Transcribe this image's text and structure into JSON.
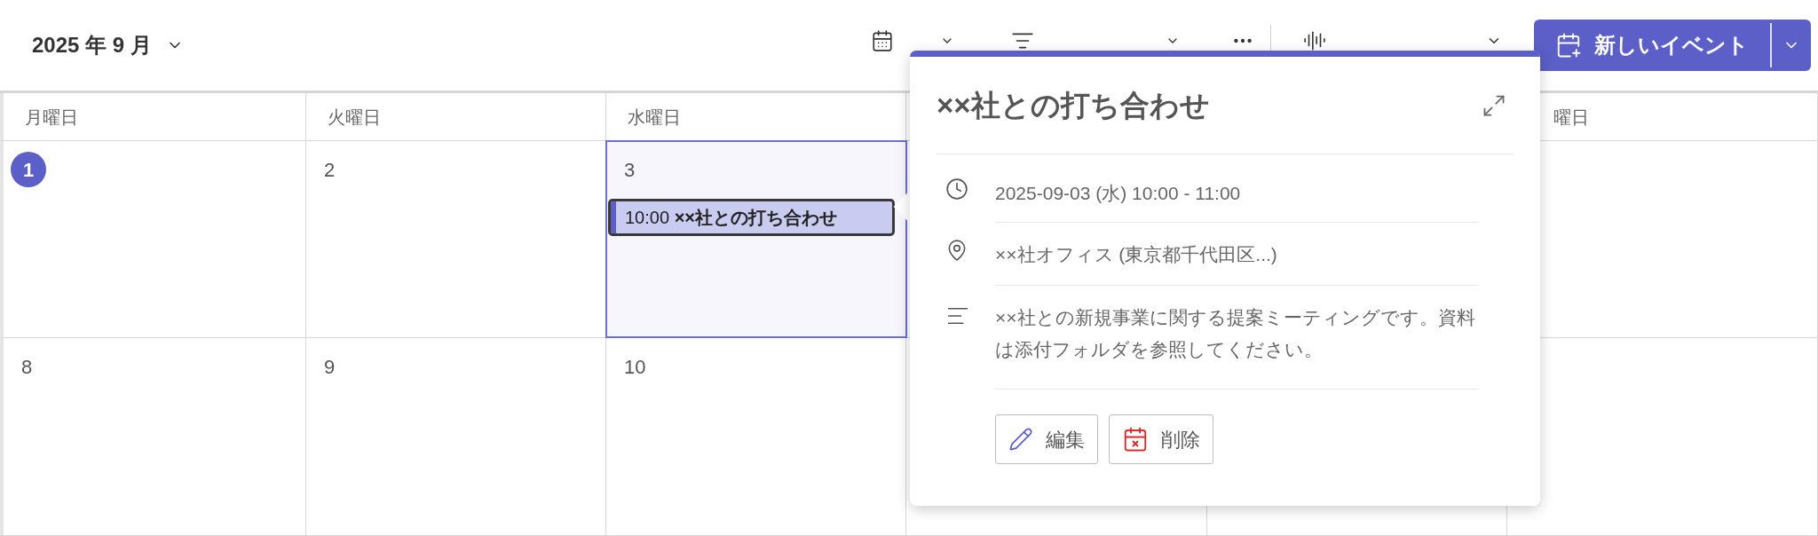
{
  "header": {
    "month_label": "2025 年 9 月"
  },
  "toolbar": {
    "new_event": "新しいイベント"
  },
  "calendar": {
    "columns": [
      {
        "header": "月曜日"
      },
      {
        "header": "火曜日"
      },
      {
        "header": "水曜日"
      }
    ],
    "partial_header": "曜日",
    "weeks": [
      [
        {
          "day": "1",
          "today": true,
          "selected": false
        },
        {
          "day": "2",
          "today": false,
          "selected": false
        },
        {
          "day": "3",
          "today": false,
          "selected": true,
          "events": [
            {
              "time": "10:00",
              "title": "××社との打ち合わせ",
              "focused": true
            }
          ]
        }
      ],
      [
        {
          "day": "8",
          "today": false,
          "selected": false
        },
        {
          "day": "9",
          "today": false,
          "selected": false
        },
        {
          "day": "10",
          "today": false,
          "selected": false
        }
      ]
    ]
  },
  "popup": {
    "title": "××社との打ち合わせ",
    "details": [
      {
        "kind": "time",
        "text": "2025-09-03 (水) 10:00 - 11:00"
      },
      {
        "kind": "location",
        "text": "××社オフィス (東京都千代田区...)"
      },
      {
        "kind": "description",
        "text": "××社との新規事業に関する提案ミーティングです。資料は添付フォルダを参照してください。"
      }
    ],
    "buttons": [
      {
        "kind": "edit",
        "label": "編集"
      },
      {
        "kind": "delete",
        "label": "削除"
      }
    ]
  }
}
